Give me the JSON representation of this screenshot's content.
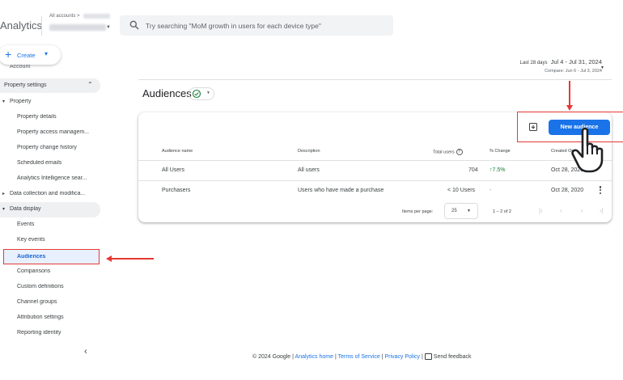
{
  "header": {
    "brand": "Analytics",
    "account_label": "All accounts >",
    "search_placeholder": "Try searching \"MoM growth in users for each device type\""
  },
  "sidebar": {
    "create_label": "Create",
    "account_item": "Account",
    "section_header": "Property settings",
    "property_group": "Property",
    "property_items": [
      "Property details",
      "Property access managem...",
      "Property change history",
      "Scheduled emails",
      "Analytics Intelligence sear..."
    ],
    "data_collection_group": "Data collection and modifica...",
    "data_display_group": "Data display",
    "data_display_items": [
      "Events",
      "Key events",
      "Audiences",
      "Comparisons",
      "Custom definitions",
      "Channel groups",
      "Attribution settings",
      "Reporting identity"
    ],
    "active_item": "Audiences",
    "collapse_icon": "chevron-left-icon"
  },
  "date_range": {
    "days_label": "Last 28 days",
    "range": "Jul 4 - Jul 31, 2024",
    "compare": "Compare: Jun 6 - Jul 3, 2024"
  },
  "page": {
    "title": "Audiences"
  },
  "table": {
    "new_button": "New audience",
    "headers": {
      "name": "Audience name",
      "description": "Description",
      "total_users": "Total users",
      "change": "% Change",
      "created": "Created On"
    },
    "rows": [
      {
        "name": "All Users",
        "description": "All users",
        "total_users": "704",
        "change_arrow": "↑",
        "change": "7.5%",
        "created": "Oct 28, 2020"
      },
      {
        "name": "Purchasers",
        "description": "Users who have made a purchase",
        "total_users": "< 10 Users",
        "change_arrow": "",
        "change": "-",
        "created": "Oct 28, 2020"
      }
    ],
    "pager": {
      "items_label": "Items per page:",
      "items_value": "25",
      "range": "1 – 2 of 2"
    }
  },
  "footer": {
    "copyright": "© 2024 Google |",
    "home_link": "Analytics home",
    "sep1": "|",
    "terms_link": "Terms of Service",
    "sep2": "|",
    "privacy_link": "Privacy Policy",
    "sep3": "|",
    "feedback": "Send feedback"
  },
  "colors": {
    "accent": "#1a73e8",
    "highlight": "#e53935",
    "positive": "#188038"
  }
}
